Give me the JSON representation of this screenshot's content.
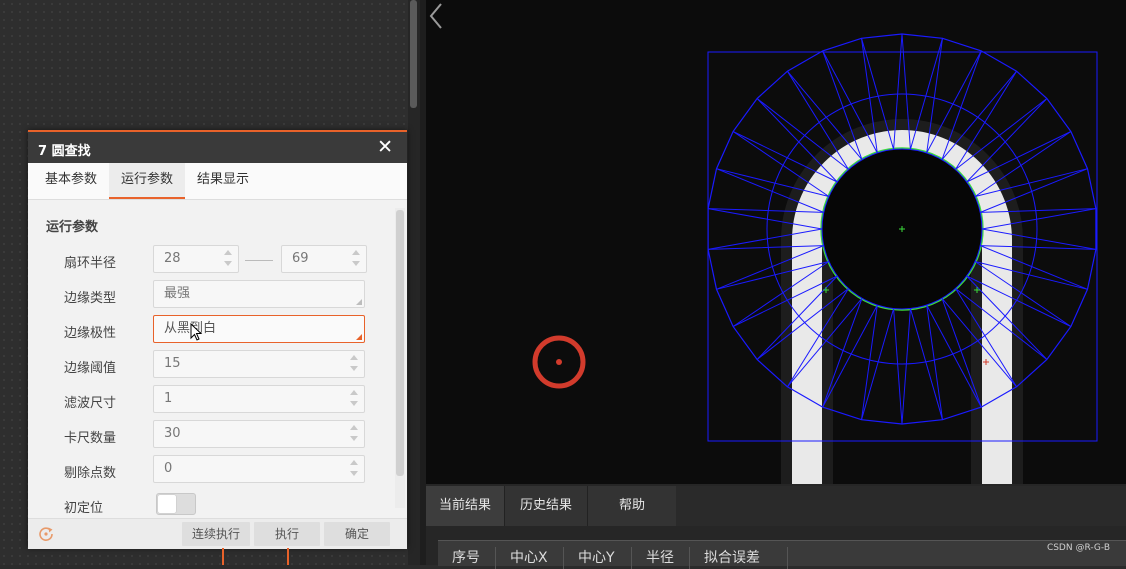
{
  "dialog": {
    "title": "7 圆查找",
    "close_glyph": "✕",
    "tabs": [
      {
        "label": "基本参数",
        "active": false
      },
      {
        "label": "运行参数",
        "active": true
      },
      {
        "label": "结果显示",
        "active": false
      }
    ],
    "section_title": "运行参数",
    "params": {
      "radius": {
        "label": "扇环半径",
        "min": "28",
        "max": "69"
      },
      "edge_type": {
        "label": "边缘类型",
        "value": "最强"
      },
      "edge_polarity": {
        "label": "边缘极性",
        "value": "从黑到白"
      },
      "edge_threshold": {
        "label": "边缘阈值",
        "value": "15"
      },
      "filter_size": {
        "label": "滤波尺寸",
        "value": "1"
      },
      "caliper_count": {
        "label": "卡尺数量",
        "value": "30"
      },
      "reject_count": {
        "label": "剔除点数",
        "value": "0"
      },
      "init_position": {
        "label": "初定位",
        "enabled": false
      }
    },
    "footer_buttons": {
      "continuous": "连续执行",
      "execute": "执行",
      "confirm": "确定"
    }
  },
  "bottom_tabs": [
    {
      "label": "当前结果",
      "active": true
    },
    {
      "label": "历史结果",
      "active": false
    },
    {
      "label": "帮助",
      "active": false
    }
  ],
  "result_columns": [
    "序号",
    "中心X",
    "中心Y",
    "半径",
    "拟合误差"
  ],
  "watermark": "CSDN @R-G-B",
  "colors": {
    "accent": "#e8622a",
    "caliper_blue": "#1a1aff",
    "fit_green": "#3cdc3c",
    "marker_red": "#d23b2c"
  }
}
